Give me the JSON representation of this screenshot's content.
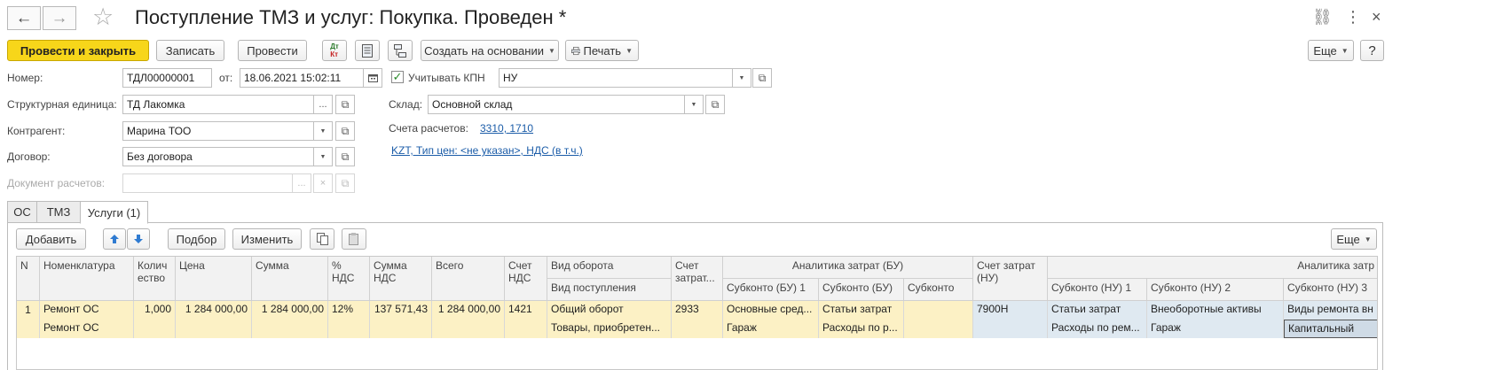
{
  "header": {
    "back_icon": "←",
    "forward_icon": "→",
    "star_icon": "☆",
    "title": "Поступление ТМЗ и услуг: Покупка. Проведен *",
    "link_icon": "⛓",
    "more_icon": "⋮",
    "close_icon": "×"
  },
  "toolbar": {
    "post_close": "Провести и закрыть",
    "save": "Записать",
    "post": "Провести",
    "dtkt_top": "Дт",
    "dtkt_bottom": "Кт",
    "create_based": "Создать на основании",
    "print": "Печать",
    "more": "Еще",
    "help": "?"
  },
  "form": {
    "number_label": "Номер:",
    "number_value": "ТДЛ00000001",
    "date_label": "от:",
    "date_value": "18.06.2021 15:02:11",
    "kpn_checked": "✓",
    "kpn_label": "Учитывать КПН",
    "kpn_value": "НУ",
    "unit_label": "Структурная единица:",
    "unit_value": "ТД Лакомка",
    "warehouse_label": "Склад:",
    "warehouse_value": "Основной склад",
    "contractor_label": "Контрагент:",
    "contractor_value": "Марина ТОО",
    "accounts_label": "Счета расчетов:",
    "accounts_value": "3310, 1710",
    "contract_label": "Договор:",
    "contract_value": "Без договора",
    "price_link": "KZT, Тип цен: <не указан>, НДС (в т.ч.)",
    "settlement_doc_label": "Документ расчетов:"
  },
  "tabs": [
    {
      "label": "ОС"
    },
    {
      "label": "ТМЗ"
    },
    {
      "label": "Услуги (1)"
    }
  ],
  "table_toolbar": {
    "add": "Добавить",
    "pick": "Подбор",
    "change": "Изменить",
    "more": "Еще"
  },
  "table": {
    "headers": {
      "n": "N",
      "nomenclature": "Номенклатура",
      "qty": "Количество",
      "price": "Цена",
      "sum": "Сумма",
      "vat_pct": "% НДС",
      "vat_sum": "Сумма НДС",
      "total": "Всего",
      "vat_account": "Счет НДС",
      "turnover_type": "Вид оборота",
      "receipt_type": "Вид поступления",
      "cost_account_bu": "Счет затрат...",
      "analytics_bu": "Аналитика затрат (БУ)",
      "subkonto_bu1": "Субконто (БУ) 1",
      "subkonto_bu2": "Субконто (БУ)",
      "subkonto_bu3": "Субконто",
      "cost_account_nu": "Счет затрат (НУ)",
      "analytics_nu": "Аналитика затр",
      "subkonto_nu1": "Субконто (НУ) 1",
      "subkonto_nu2": "Субконто (НУ) 2",
      "subkonto_nu3": "Субконто (НУ) 3"
    },
    "row": {
      "n": "1",
      "nomenclature": "Ремонт ОС",
      "nomenclature2": "Ремонт ОС",
      "qty": "1,000",
      "price": "1 284 000,00",
      "sum": "1 284 000,00",
      "vat_pct": "12%",
      "vat_sum": "137 571,43",
      "total": "1 284 000,00",
      "vat_account": "1421",
      "turnover_type": "Общий оборот",
      "receipt_type": "Товары, приобретен...",
      "cost_account_bu": "2933",
      "subkonto_bu1_a": "Основные сред...",
      "subkonto_bu1_b": "Гараж",
      "subkonto_bu2_a": "Статьи затрат",
      "subkonto_bu2_b": "Расходы по р...",
      "cost_account_nu": "7900Н",
      "subkonto_nu1_a": "Статьи затрат",
      "subkonto_nu1_b": "Расходы по рем...",
      "subkonto_nu2_a": "Внеоборотные активы",
      "subkonto_nu2_b": "Гараж",
      "subkonto_nu3_a": "Виды ремонта вн",
      "subkonto_nu3_b": "Капитальный"
    }
  },
  "colors": {
    "primary": "#f7d61a",
    "row_yellow": "#fcf1c5",
    "row_blue": "#dfe9f1",
    "link": "#1b5ca8"
  }
}
